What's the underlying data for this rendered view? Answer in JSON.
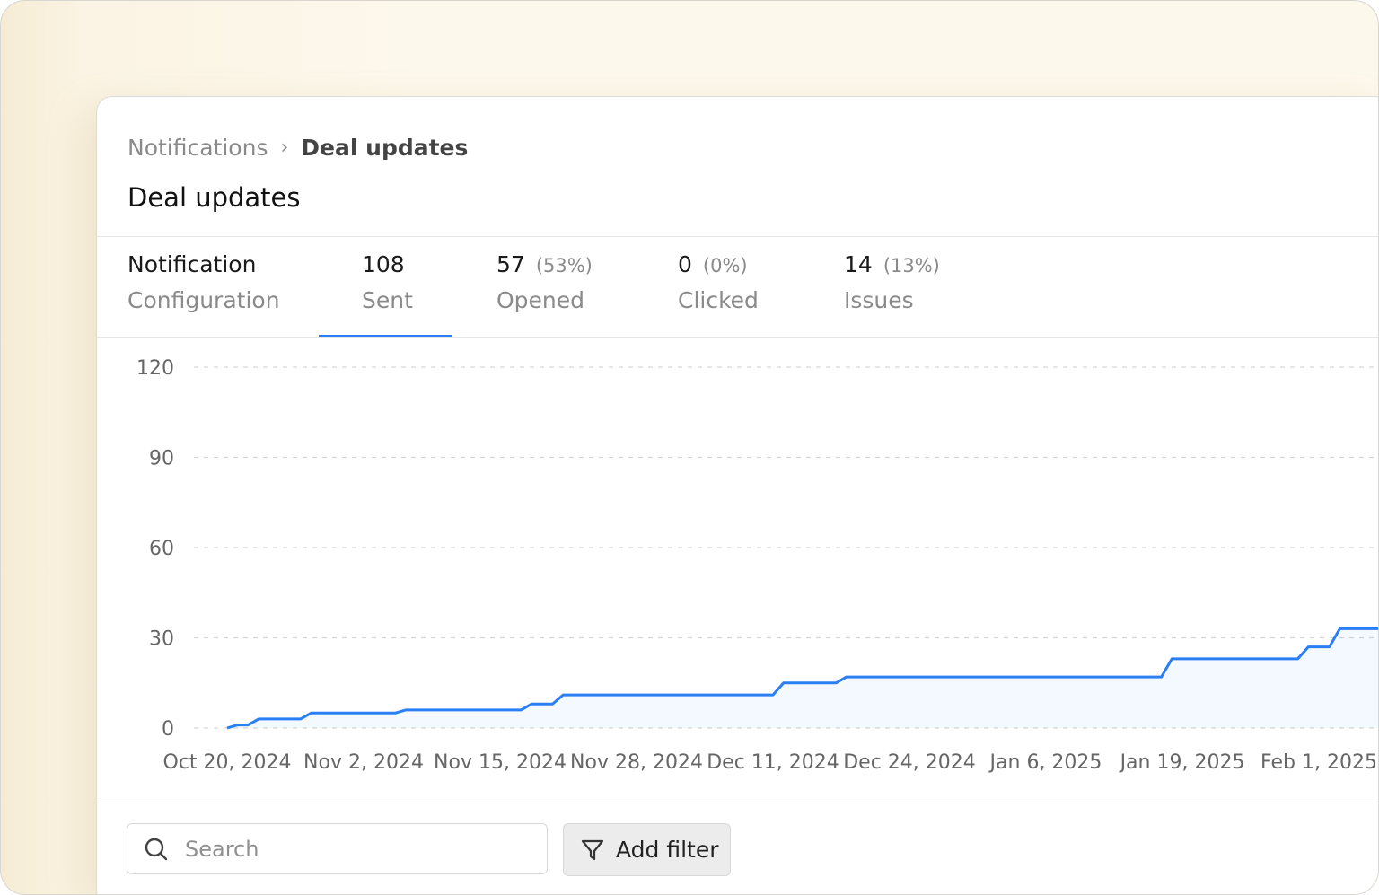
{
  "breadcrumb": {
    "parent": "Notifications",
    "separator": "›",
    "current": "Deal updates"
  },
  "page_title": "Deal updates",
  "tabs": [
    {
      "top": "Notification",
      "pct": "",
      "bottom": "Configuration"
    },
    {
      "top": "108",
      "pct": "",
      "bottom": "Sent"
    },
    {
      "top": "57",
      "pct": "(53%)",
      "bottom": "Opened"
    },
    {
      "top": "0",
      "pct": "(0%)",
      "bottom": "Clicked"
    },
    {
      "top": "14",
      "pct": "(13%)",
      "bottom": "Issues"
    }
  ],
  "active_tab": "Sent",
  "accent_color": "#2a7ff6",
  "chart_data": {
    "type": "line",
    "title": "",
    "xlabel": "",
    "ylabel": "",
    "ylim": [
      0,
      120
    ],
    "yticks": [
      0,
      30,
      60,
      90,
      120
    ],
    "xtick_labels": [
      "Oct 20, 2024",
      "Nov 2, 2024",
      "Nov 15, 2024",
      "Nov 28, 2024",
      "Dec 11, 2024",
      "Dec 24, 2024",
      "Jan 6, 2025",
      "Jan 19, 2025",
      "Feb 1, 2025"
    ],
    "grid": true,
    "series": [
      {
        "color": "#2a7ff6",
        "points": [
          [
            "2024-10-20",
            0
          ],
          [
            "2024-10-21",
            1
          ],
          [
            "2024-10-22",
            1
          ],
          [
            "2024-10-23",
            3
          ],
          [
            "2024-10-27",
            3
          ],
          [
            "2024-10-28",
            5
          ],
          [
            "2024-11-05",
            5
          ],
          [
            "2024-11-06",
            6
          ],
          [
            "2024-11-17",
            6
          ],
          [
            "2024-11-18",
            8
          ],
          [
            "2024-11-20",
            8
          ],
          [
            "2024-11-21",
            11
          ],
          [
            "2024-12-11",
            11
          ],
          [
            "2024-12-12",
            15
          ],
          [
            "2024-12-17",
            15
          ],
          [
            "2024-12-18",
            17
          ],
          [
            "2025-01-17",
            17
          ],
          [
            "2025-01-18",
            23
          ],
          [
            "2025-01-30",
            23
          ],
          [
            "2025-01-31",
            27
          ],
          [
            "2025-02-02",
            27
          ],
          [
            "2025-02-03",
            33
          ],
          [
            "2025-02-08",
            33
          ],
          [
            "2025-02-09",
            37
          ]
        ]
      }
    ]
  },
  "search": {
    "placeholder": "Search",
    "icon": "search-icon"
  },
  "filter_button": {
    "label": "Add filter",
    "icon": "filter-icon"
  }
}
